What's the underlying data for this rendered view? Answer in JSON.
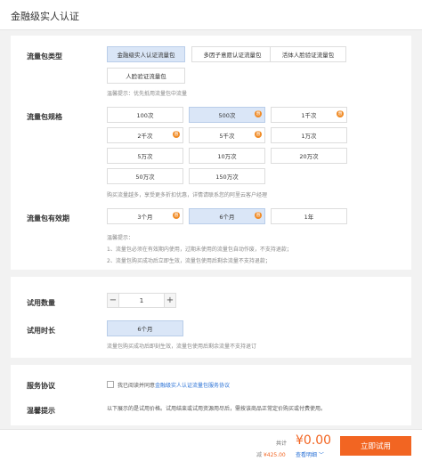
{
  "header": {
    "title": "金融级实人认证"
  },
  "package_type": {
    "label": "流量包类型",
    "options": [
      "金融级实人认证流量包",
      "多因子意愿认证流量包",
      "活体人脸验证流量包",
      "人脸验证流量包"
    ],
    "hint": "温馨提示：优先抵用流量包中流量"
  },
  "package_spec": {
    "label": "流量包规格",
    "options": [
      "100次",
      "500次",
      "1千次",
      "2千次",
      "5千次",
      "1万次",
      "5万次",
      "10万次",
      "20万次",
      "50万次",
      "150万次"
    ],
    "hint": "购买流量越多，享受更多折扣优惠，详情请联系您的阿里云客户经理"
  },
  "validity": {
    "label": "流量包有效期",
    "options": [
      "3个月",
      "6个月",
      "1年"
    ],
    "hint_title": "温馨提示：",
    "hint_1": "1、流量包必须在有效期内使用，过期未使用的流量包自动作废，不支持退款；",
    "hint_2": "2、流量包购买成功后立即生效，流量包使用后剩余流量不支持退款；"
  },
  "trial": {
    "quantity_label": "试用数量",
    "quantity_value": "1",
    "minus": "−",
    "plus": "+",
    "duration_label": "试用时长",
    "duration_value": "6个月",
    "hint": "流量包购买成功后即刻生效，流量包使用后剩余流量不支持退订"
  },
  "agreement": {
    "label": "服务协议",
    "text": "我已阅读并同意",
    "link": "金融级实人认证流量包服务协议"
  },
  "notice": {
    "label": "温馨提示",
    "text": "以下展示的是试用价格。试用结束或试用资源用尽后，需按该商品正常定价购买或付费使用。"
  },
  "footer": {
    "total_label": "共计",
    "total_value": "¥0.00",
    "discount_prefix": "减",
    "discount_value": "¥425.00",
    "detail_link": "查看明细 ﹀",
    "buy_button": "立即试用"
  },
  "tag_glyph": "惠",
  "colors": {
    "accent": "#f26522",
    "selected": "#dae6f7",
    "link": "#2a72d6"
  }
}
